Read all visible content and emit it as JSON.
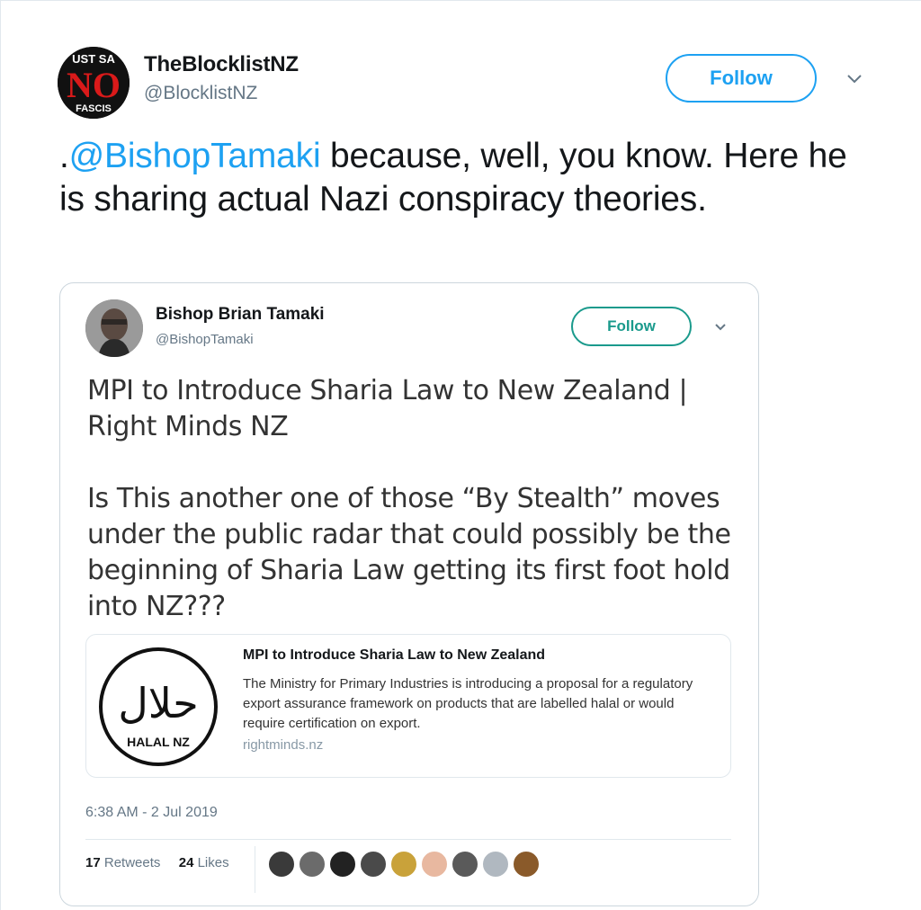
{
  "tweet": {
    "author": {
      "name": "TheBlocklistNZ",
      "handle": "@BlocklistNZ",
      "avatar_text": [
        "UST SA",
        "NO",
        "FASCIS"
      ]
    },
    "follow_label": "Follow",
    "text_prefix": ".",
    "mention": "@BishopTamaki",
    "text_rest": " because, well, you know. Here he is sharing actual Nazi conspiracy theories."
  },
  "quoted": {
    "author": {
      "name": "Bishop Brian Tamaki",
      "handle": "@BishopTamaki"
    },
    "follow_label": "Follow",
    "paragraph_1": "MPI to Introduce Sharia Law to New Zealand | Right Minds NZ",
    "paragraph_2": "Is This another one of those “By Stealth” moves under the public radar that could possibly be the beginning of Sharia Law getting its first foot hold into NZ???",
    "link_card": {
      "logo_text": "HALAL NZ",
      "logo_arabic": "حلال",
      "title": "MPI to Introduce Sharia Law to New Zealand",
      "description": "The Ministry for Primary Industries is introducing a proposal for a regulatory export assurance framework on products that are labelled halal or would require certification on export.",
      "domain": "rightminds.nz"
    },
    "timestamp": "6:38 AM - 2 Jul 2019",
    "retweets_count": "17",
    "retweets_label": "Retweets",
    "likes_count": "24",
    "likes_label": "Likes",
    "liker_avatars": [
      "#3a3a3a",
      "#6b6b6b",
      "#222222",
      "#4a4a4a",
      "#c9a23a",
      "#e8b8a0",
      "#5a5a5a",
      "#b0b8c0",
      "#8a5a2a"
    ]
  },
  "colors": {
    "accent": "#1da1f2",
    "follow_quoted": "#1a9a8c"
  }
}
